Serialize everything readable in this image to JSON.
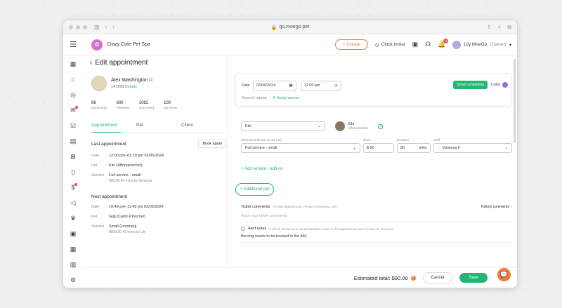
{
  "browser": {
    "url": "go.moego.pet"
  },
  "topbar": {
    "business_name": "Crazy Cute Pet Spa",
    "create_label": "+ Create",
    "clock_label": "Clock in/out",
    "notif_count": "4",
    "user_name": "Lily MoeGo",
    "user_role": "(Owner)"
  },
  "page": {
    "title": "Edit appointment"
  },
  "client": {
    "name": "Alex Washington",
    "id": "147258",
    "details_link": "Details",
    "stats": [
      {
        "value": "96",
        "label": "Upcoming"
      },
      {
        "value": "600",
        "label": "Finished"
      },
      {
        "value": "1082",
        "label": "Cancelled"
      },
      {
        "value": "109",
        "label": "No-show"
      }
    ]
  },
  "left_tabs": [
    "Appointment",
    "Pet",
    "Client"
  ],
  "last_appt": {
    "heading": "Last appointment",
    "book_again": "Book again",
    "date_k": "Date",
    "date": "12:00 pm–01:20 pm 02/05/2024",
    "pet_k": "Pet",
    "pet": "Kiki (Affenpinscher)",
    "service_k": "Service",
    "service": "Full service - small",
    "service_note": "$90.00  80 mins by Vanessa"
  },
  "next_appt": {
    "heading": "Next appointment",
    "date_k": "Date",
    "date": "10:49 pm–11:49 pm 02/05/2024",
    "pet_k": "Pet",
    "pet": "Gigi (Carlin Pinscher)",
    "service_k": "Service",
    "service": "Small Grooming",
    "service_note": "$600.00  49 mins by Lily"
  },
  "schedule": {
    "date_label": "Date",
    "date": "02/06/2024",
    "time": "12:00 pm",
    "smart": "Smart scheduling",
    "color_label": "Color",
    "repeat_status": "Doesn't repeat",
    "setup_repeat": "Setup repeat",
    "color": "#9b6bd8"
  },
  "pet": {
    "selected": "Kiki",
    "name": "Kiki",
    "breed": "Affenpinscher"
  },
  "service": {
    "service_label": "Service(12:00 pm–01:20 pm)",
    "service_value": "Full service - small",
    "price_label": "Price",
    "price_value": "$ 90",
    "duration_label": "Duration",
    "duration_value": "80",
    "duration_unit": "mins",
    "staff_label": "Staff",
    "staff_value": "Vanessa F"
  },
  "actions": {
    "add_service": "+ Add service / add-on",
    "additional_pet": "+ Additional pet"
  },
  "comments": {
    "title": "Ticket comments",
    "note": "For this appointment. Private to business only",
    "history": "History comments",
    "placeholder": "Input your ticket comments"
  },
  "alert": {
    "title": "Alert notes",
    "note": "It will be shown as a red exclamation mark on the appointment card. Private for business.",
    "value": "the dog needs to be booked in the AM"
  },
  "footer": {
    "total": "Estimated total: $90.00",
    "cancel": "Cancel",
    "save": "Save"
  }
}
